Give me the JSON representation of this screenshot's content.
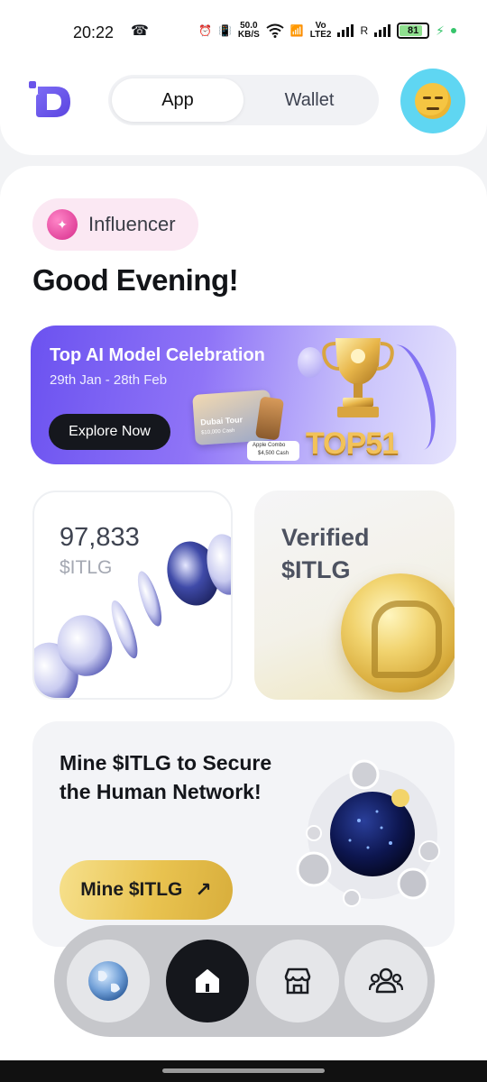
{
  "status_bar": {
    "time": "20:22",
    "net_speed_value": "50.0",
    "net_speed_unit": "KB/S",
    "vo_label": "Vo",
    "lte_label": "LTE2",
    "roaming_label": "R",
    "battery": "81"
  },
  "header": {
    "logo_icon": "itlg-logo-icon",
    "tabs": [
      {
        "label": "App",
        "active": true
      },
      {
        "label": "Wallet",
        "active": false
      }
    ],
    "avatar_icon": "expressionless-face-emoji"
  },
  "profile": {
    "role": "Influencer",
    "greeting": "Good Evening!"
  },
  "banner": {
    "title": "Top AI Model Celebration",
    "dates": "29th Jan - 28th Feb",
    "cta": "Explore Now",
    "prize_card_title": "Dubai Tour",
    "prize_card_value": "$10,000 Cash",
    "apple_tag_title": "Apple Combo",
    "apple_tag_value": "$4,500 Cash",
    "trophy_text": "TOP51"
  },
  "balance_tile": {
    "value": "97,833",
    "unit": "$ITLG"
  },
  "verified_tile": {
    "label": "Verified $ITLG"
  },
  "mine_card": {
    "title": "Mine $ITLG to Secure the Human Network!",
    "button_label": "Mine $ITLG",
    "button_icon": "arrow-up-right-icon"
  },
  "bottom_nav": {
    "items": [
      {
        "icon": "globe-icon",
        "active": false
      },
      {
        "icon": "home-icon",
        "active": true
      },
      {
        "icon": "store-icon",
        "active": false
      },
      {
        "icon": "people-icon",
        "active": false
      }
    ]
  },
  "colors": {
    "accent_purple": "#6b52f0",
    "gold": "#e9c350",
    "avatar_bg": "#5fd6f2",
    "influencer_chip": "#fbe8f3"
  }
}
